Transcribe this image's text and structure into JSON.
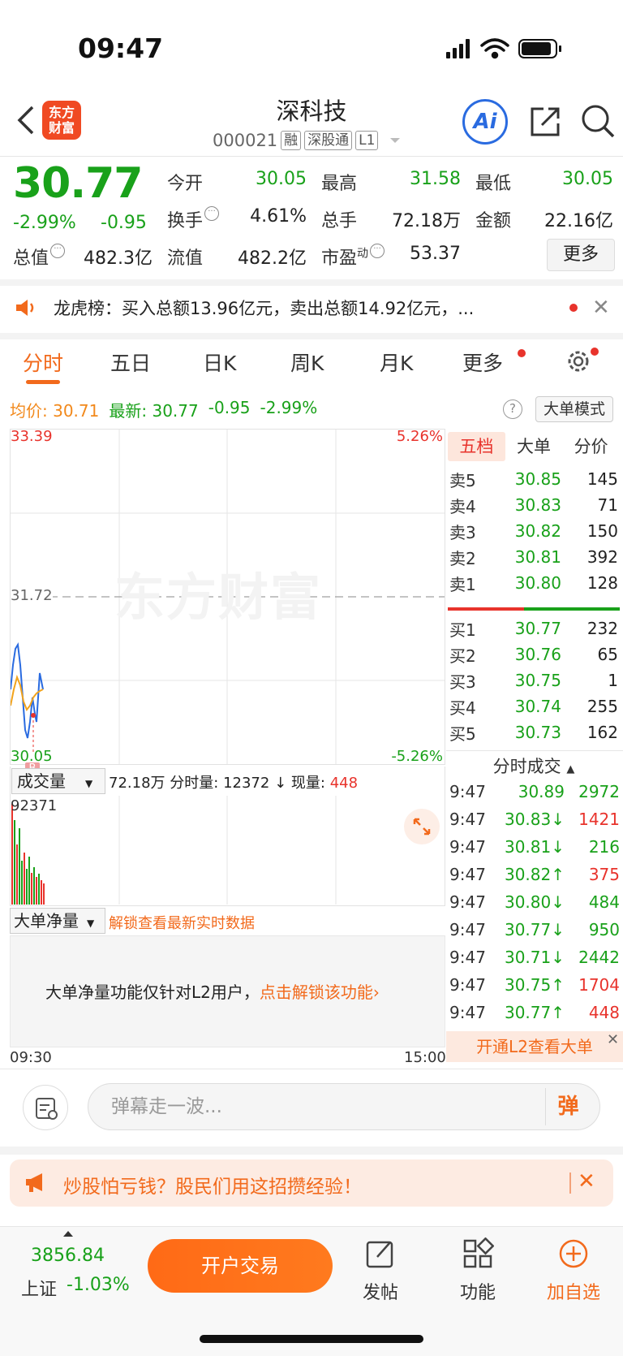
{
  "status": {
    "time": "09:47"
  },
  "header": {
    "logo_text_1": "东方",
    "logo_text_2": "财富",
    "stock_name": "深科技",
    "stock_code": "000021",
    "tags": [
      "融",
      "深股通",
      "L1"
    ],
    "ai_label": "Ai"
  },
  "quote": {
    "price": "30.77",
    "change_pct": "-2.99%",
    "change": "-0.95",
    "open_label": "今开",
    "open": "30.05",
    "high_label": "最高",
    "high": "31.58",
    "low_label": "最低",
    "low": "30.05",
    "turnover_label": "换手",
    "turnover": "4.61%",
    "volume_label": "总手",
    "volume": "72.18万",
    "amount_label": "金额",
    "amount": "22.16亿",
    "mktcap_label": "总值",
    "mktcap": "482.3亿",
    "float_label": "流值",
    "float": "482.2亿",
    "pe_label": "市盈",
    "pe_sup": "动",
    "pe": "53.37",
    "more_label": "更多"
  },
  "ticker": {
    "text": "龙虎榜：买入总额13.96亿元，卖出总额14.92亿元，..."
  },
  "tabs": [
    "分时",
    "五日",
    "日K",
    "周K",
    "月K",
    "更多"
  ],
  "info_row": {
    "avg_label": "均价:",
    "avg": "30.71",
    "latest_label": "最新:",
    "latest": "30.77",
    "chg": "-0.95",
    "pct": "-2.99%",
    "help": "?",
    "mode_label": "大单模式"
  },
  "chart": {
    "top_price": "33.39",
    "top_pct": "5.26%",
    "mid_price": "31.72",
    "bottom_price": "30.05",
    "bottom_pct": "-5.26%",
    "watermark": "东方财富",
    "b_marker": "B",
    "time_start": "09:30",
    "time_end": "15:00"
  },
  "volume": {
    "selector": "成交量",
    "total": "72.18万",
    "minute_label": "分时量:",
    "minute": "12372",
    "now_label": "现量:",
    "now": "448",
    "max": "92371"
  },
  "net": {
    "selector": "大单净量",
    "unlock_link": "解锁查看最新实时数据",
    "msg": "大单净量功能仅针对L2用户，",
    "msg_link": "点击解锁该功能"
  },
  "orderbook": {
    "tabs": [
      "五档",
      "大单",
      "分价"
    ],
    "asks": [
      {
        "label": "卖5",
        "price": "30.85",
        "vol": "145"
      },
      {
        "label": "卖4",
        "price": "30.83",
        "vol": "71"
      },
      {
        "label": "卖3",
        "price": "30.82",
        "vol": "150"
      },
      {
        "label": "卖2",
        "price": "30.81",
        "vol": "392"
      },
      {
        "label": "卖1",
        "price": "30.80",
        "vol": "128"
      }
    ],
    "bids": [
      {
        "label": "买1",
        "price": "30.77",
        "vol": "232"
      },
      {
        "label": "买2",
        "price": "30.76",
        "vol": "65"
      },
      {
        "label": "买3",
        "price": "30.75",
        "vol": "1"
      },
      {
        "label": "买4",
        "price": "30.74",
        "vol": "255"
      },
      {
        "label": "买5",
        "price": "30.73",
        "vol": "162"
      }
    ],
    "trades_title": "分时成交",
    "trades": [
      {
        "time": "9:47",
        "price": "30.89",
        "vol": "2972",
        "dir": "",
        "color": "green"
      },
      {
        "time": "9:47",
        "price": "30.83↓",
        "vol": "1421",
        "dir": "down",
        "color": "red"
      },
      {
        "time": "9:47",
        "price": "30.81↓",
        "vol": "216",
        "dir": "down",
        "color": "green"
      },
      {
        "time": "9:47",
        "price": "30.82↑",
        "vol": "375",
        "dir": "up",
        "color": "red"
      },
      {
        "time": "9:47",
        "price": "30.80↓",
        "vol": "484",
        "dir": "down",
        "color": "green"
      },
      {
        "time": "9:47",
        "price": "30.77↓",
        "vol": "950",
        "dir": "down",
        "color": "green"
      },
      {
        "time": "9:47",
        "price": "30.71↓",
        "vol": "2442",
        "dir": "down",
        "color": "green"
      },
      {
        "time": "9:47",
        "price": "30.75↑",
        "vol": "1704",
        "dir": "up",
        "color": "red"
      },
      {
        "time": "9:47",
        "price": "30.77↑",
        "vol": "448",
        "dir": "up",
        "color": "red"
      }
    ],
    "l2_banner": "开通L2查看大单"
  },
  "barrage": {
    "placeholder": "弹幕走一波...",
    "send_label": "弹"
  },
  "promo": {
    "text": "炒股怕亏钱？股民们用这招攒经验！"
  },
  "bottom": {
    "index_value": "3856.84",
    "index_name": "上证",
    "index_chg": "-1.03%",
    "trade_label": "开户交易",
    "nav": [
      "发帖",
      "功能",
      "加自选"
    ]
  },
  "colors": {
    "up": "#e8332c",
    "down": "#19a11a",
    "accent": "#f26a1c"
  }
}
